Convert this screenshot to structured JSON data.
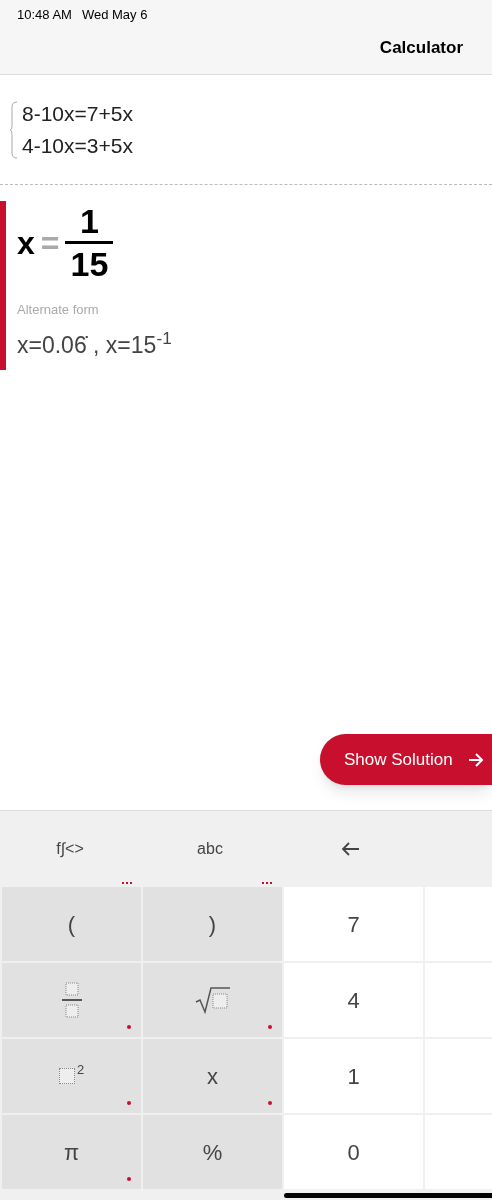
{
  "status_bar": {
    "time": "10:48 AM",
    "date": "Wed May 6"
  },
  "header": {
    "title": "Calculator"
  },
  "equations": [
    "8-10x=7+5x",
    "4-10x=3+5x"
  ],
  "result": {
    "variable": "x",
    "equals": "=",
    "numerator": "1",
    "denominator": "15",
    "alternate_label": "Alternate form",
    "alternate": "x=0.06̇ , x=15$^{-1}$"
  },
  "show_solution": {
    "label": "Show Solution"
  },
  "keyboard": {
    "tabs": [
      {
        "label": "f∫<>",
        "more": true
      },
      {
        "label": "abc",
        "more": true
      }
    ],
    "keys": [
      {
        "kind": "text",
        "label": "(",
        "more": false
      },
      {
        "kind": "text",
        "label": ")",
        "more": false
      },
      {
        "kind": "digit",
        "label": "7",
        "more": false
      },
      {
        "kind": "blank"
      },
      {
        "kind": "fraction",
        "more": true
      },
      {
        "kind": "sqrt",
        "more": true
      },
      {
        "kind": "digit",
        "label": "4",
        "more": false
      },
      {
        "kind": "blank"
      },
      {
        "kind": "square",
        "label": "2",
        "more": true
      },
      {
        "kind": "text",
        "label": "x",
        "more": true
      },
      {
        "kind": "digit",
        "label": "1",
        "more": false
      },
      {
        "kind": "blank"
      },
      {
        "kind": "text",
        "label": "π",
        "more": true
      },
      {
        "kind": "text",
        "label": "%",
        "more": false
      },
      {
        "kind": "digit",
        "label": "0",
        "more": false
      },
      {
        "kind": "blank"
      }
    ]
  }
}
